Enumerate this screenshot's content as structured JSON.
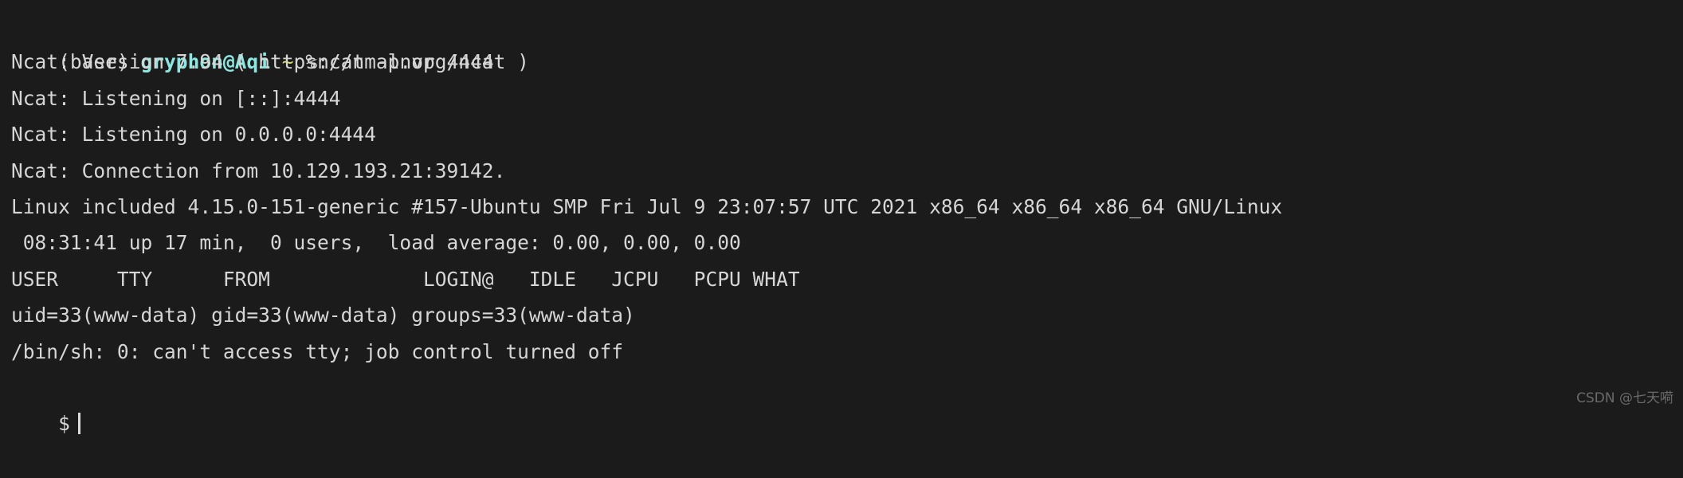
{
  "terminal": {
    "background_color": "#1b1b1b",
    "foreground_color": "#d6d6d6",
    "host_color": "#8ee6e0",
    "path_color": "#d4e06a",
    "prompt": {
      "env": "(base) ",
      "host": "gryphon@Aqi",
      "space1": " ",
      "path": "~",
      "space2": " ",
      "command": "%ncat -lnvp 4444"
    },
    "lines": [
      "Ncat: Version 7.94 ( https://nmap.org/ncat )",
      "Ncat: Listening on [::]:4444",
      "Ncat: Listening on 0.0.0.0:4444",
      "Ncat: Connection from 10.129.193.21:39142.",
      "Linux included 4.15.0-151-generic #157-Ubuntu SMP Fri Jul 9 23:07:57 UTC 2021 x86_64 x86_64 x86_64 GNU/Linux",
      " 08:31:41 up 17 min,  0 users,  load average: 0.00, 0.00, 0.00",
      "USER     TTY      FROM             LOGIN@   IDLE   JCPU   PCPU WHAT",
      "uid=33(www-data) gid=33(www-data) groups=33(www-data)",
      "/bin/sh: 0: can't access tty; job control turned off"
    ],
    "shell_prompt": "$",
    "watermark": "CSDN @七天嗬"
  }
}
